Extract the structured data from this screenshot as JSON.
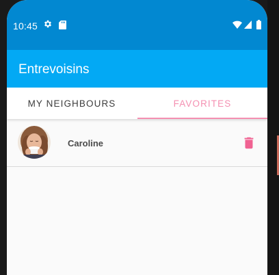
{
  "status_bar": {
    "time": "10:45",
    "icons": [
      "gear-icon",
      "sd-card-icon",
      "wifi-icon",
      "signal-icon",
      "battery-icon"
    ]
  },
  "app_bar": {
    "title": "Entrevoisins",
    "color": "#03a9f4"
  },
  "tabs": [
    {
      "label": "MY NEIGHBOURS",
      "selected": false
    },
    {
      "label": "FAVORITES",
      "selected": true
    }
  ],
  "accent_color": "#f48fb1",
  "favorites": [
    {
      "name": "Caroline",
      "avatar": "avatar-photo",
      "action_icon": "trash-icon"
    }
  ]
}
